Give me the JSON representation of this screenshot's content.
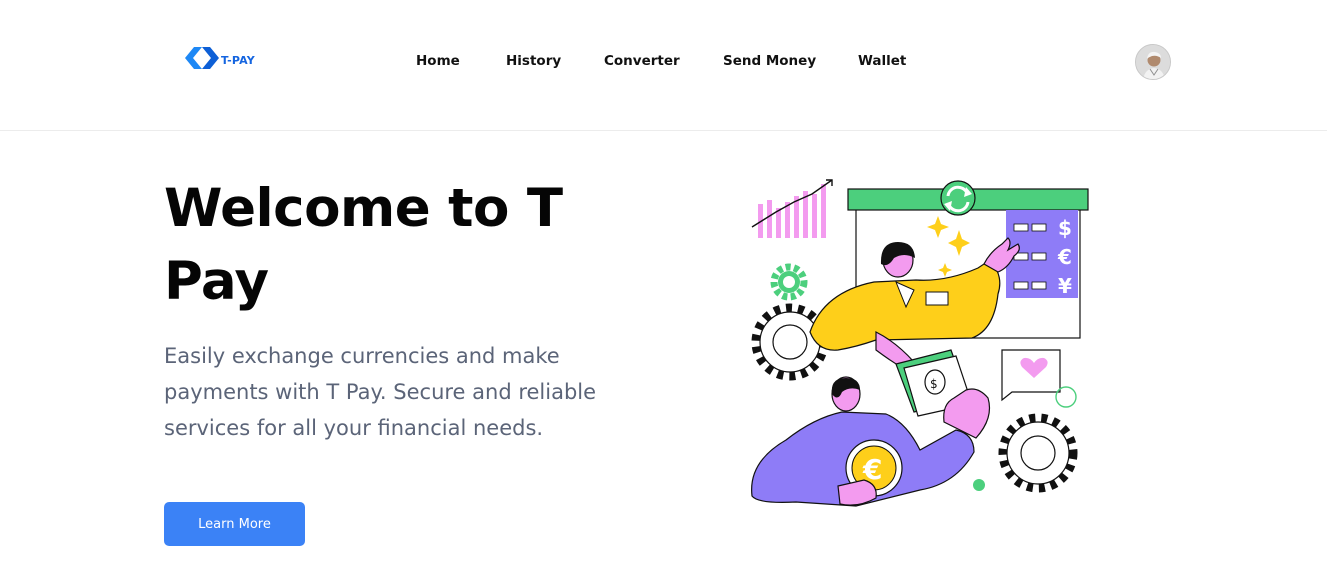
{
  "nav": {
    "logo_text": "T-PAY",
    "links": [
      {
        "label": "Home"
      },
      {
        "label": "History"
      },
      {
        "label": "Converter"
      },
      {
        "label": "Send Money"
      },
      {
        "label": "Wallet"
      }
    ]
  },
  "hero": {
    "title": "Welcome to T Pay",
    "description": "Easily exchange currencies and make payments with T Pay. Secure and reliable services for all your financial needs.",
    "cta_label": "Learn More"
  },
  "illustration": {
    "currency_symbols": [
      "$",
      "€",
      "¥"
    ],
    "coin_symbol": "€",
    "banknote_symbol": "$"
  },
  "colors": {
    "primary_button": "#3b82f6",
    "logo_blue": "#1565e0",
    "green_accent": "#4ccf7d",
    "purple_accent": "#8e7cf7",
    "yellow_accent": "#fecf1a",
    "pink_accent": "#f39bef"
  }
}
